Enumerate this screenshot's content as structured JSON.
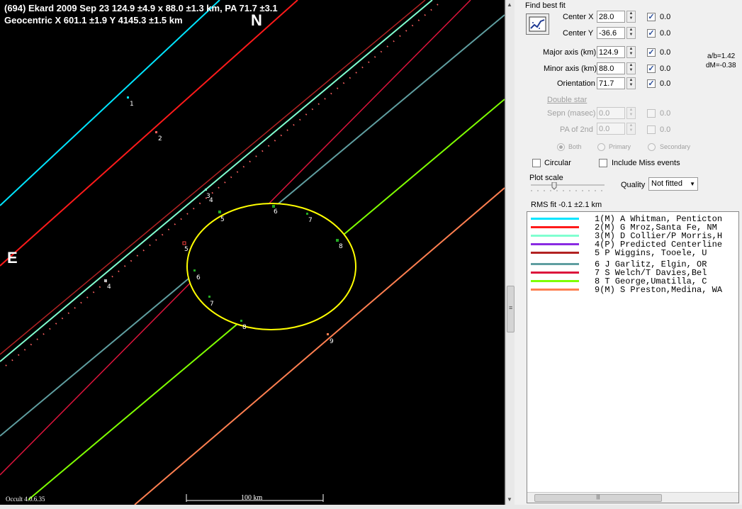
{
  "header": {
    "line1": "(694) Ekard  2009 Sep 23   124.9 ±4.9 x 88.0 ±1.3 km,  PA 71.7 ±3.1",
    "line2": "Geocentric  X  601.1 ±1.9   Y 4145.3 ±1.5 km"
  },
  "plot": {
    "north_label": "N",
    "east_label": "E",
    "version_label": "Occult 4.0.6.35",
    "scale_label": "100 km",
    "ellipse_color": "#ffff00",
    "chord_labels": [
      "1",
      "2",
      "3",
      "4",
      "5",
      "6",
      "7",
      "8",
      "9",
      "4",
      "5",
      "6",
      "7",
      "8"
    ]
  },
  "panel": {
    "find_best_fit": "Find best fit",
    "fit_button_icon": "chart-fit-icon",
    "center_x_label": "Center X",
    "center_x_value": "28.0",
    "center_x_check": "0.0",
    "center_y_label": "Center Y",
    "center_y_value": "-36.6",
    "center_y_check": "0.0",
    "major_label": "Major axis (km)",
    "major_value": "124.9",
    "major_check": "0.0",
    "minor_label": "Minor axis (km)",
    "minor_value": "88.0",
    "minor_check": "0.0",
    "orient_label": "Orientation",
    "orient_value": "71.7",
    "orient_check": "0.0",
    "ab_ratio": "a/b=1.42",
    "dm": "dM=-0.38",
    "double_star": "Double star",
    "sepn_label": "Sepn (masec)",
    "sepn_value": "0.0",
    "sepn_check": "0.0",
    "pa2_label": "PA of 2nd",
    "pa2_value": "0.0",
    "pa2_check": "0.0",
    "radio_both": "Both",
    "radio_primary": "Primary",
    "radio_secondary": "Secondary",
    "circular": "Circular",
    "include_miss": "Include Miss events",
    "plot_scale": "Plot scale",
    "quality_label": "Quality",
    "quality_value": "Not fitted",
    "rms_fit": "RMS fit -0.1 ±2.1 km"
  },
  "legend": [
    {
      "text": "1(M) A Whitman, Penticton",
      "color": "#00e5ff"
    },
    {
      "text": "2(M) G Mroz,Santa Fe, NM",
      "color": "#ff1a1a"
    },
    {
      "text": "3(M) D Collier/P Morris,H",
      "color": "#80ffd0"
    },
    {
      "text": "4(P) Predicted Centerline",
      "color": "#8a2be2"
    },
    {
      "text": "5    P Wiggins, Tooele, U",
      "color": "#b22222"
    },
    {
      "text": "6    J Garlitz, Elgin, OR",
      "color": "#5f9ea0"
    },
    {
      "text": "7    S Welch/T Davies,Bel",
      "color": "#dc143c"
    },
    {
      "text": "8    T George,Umatilla, C",
      "color": "#7fff00"
    },
    {
      "text": "9(M) S Preston,Medina, WA",
      "color": "#ff7f50"
    }
  ]
}
